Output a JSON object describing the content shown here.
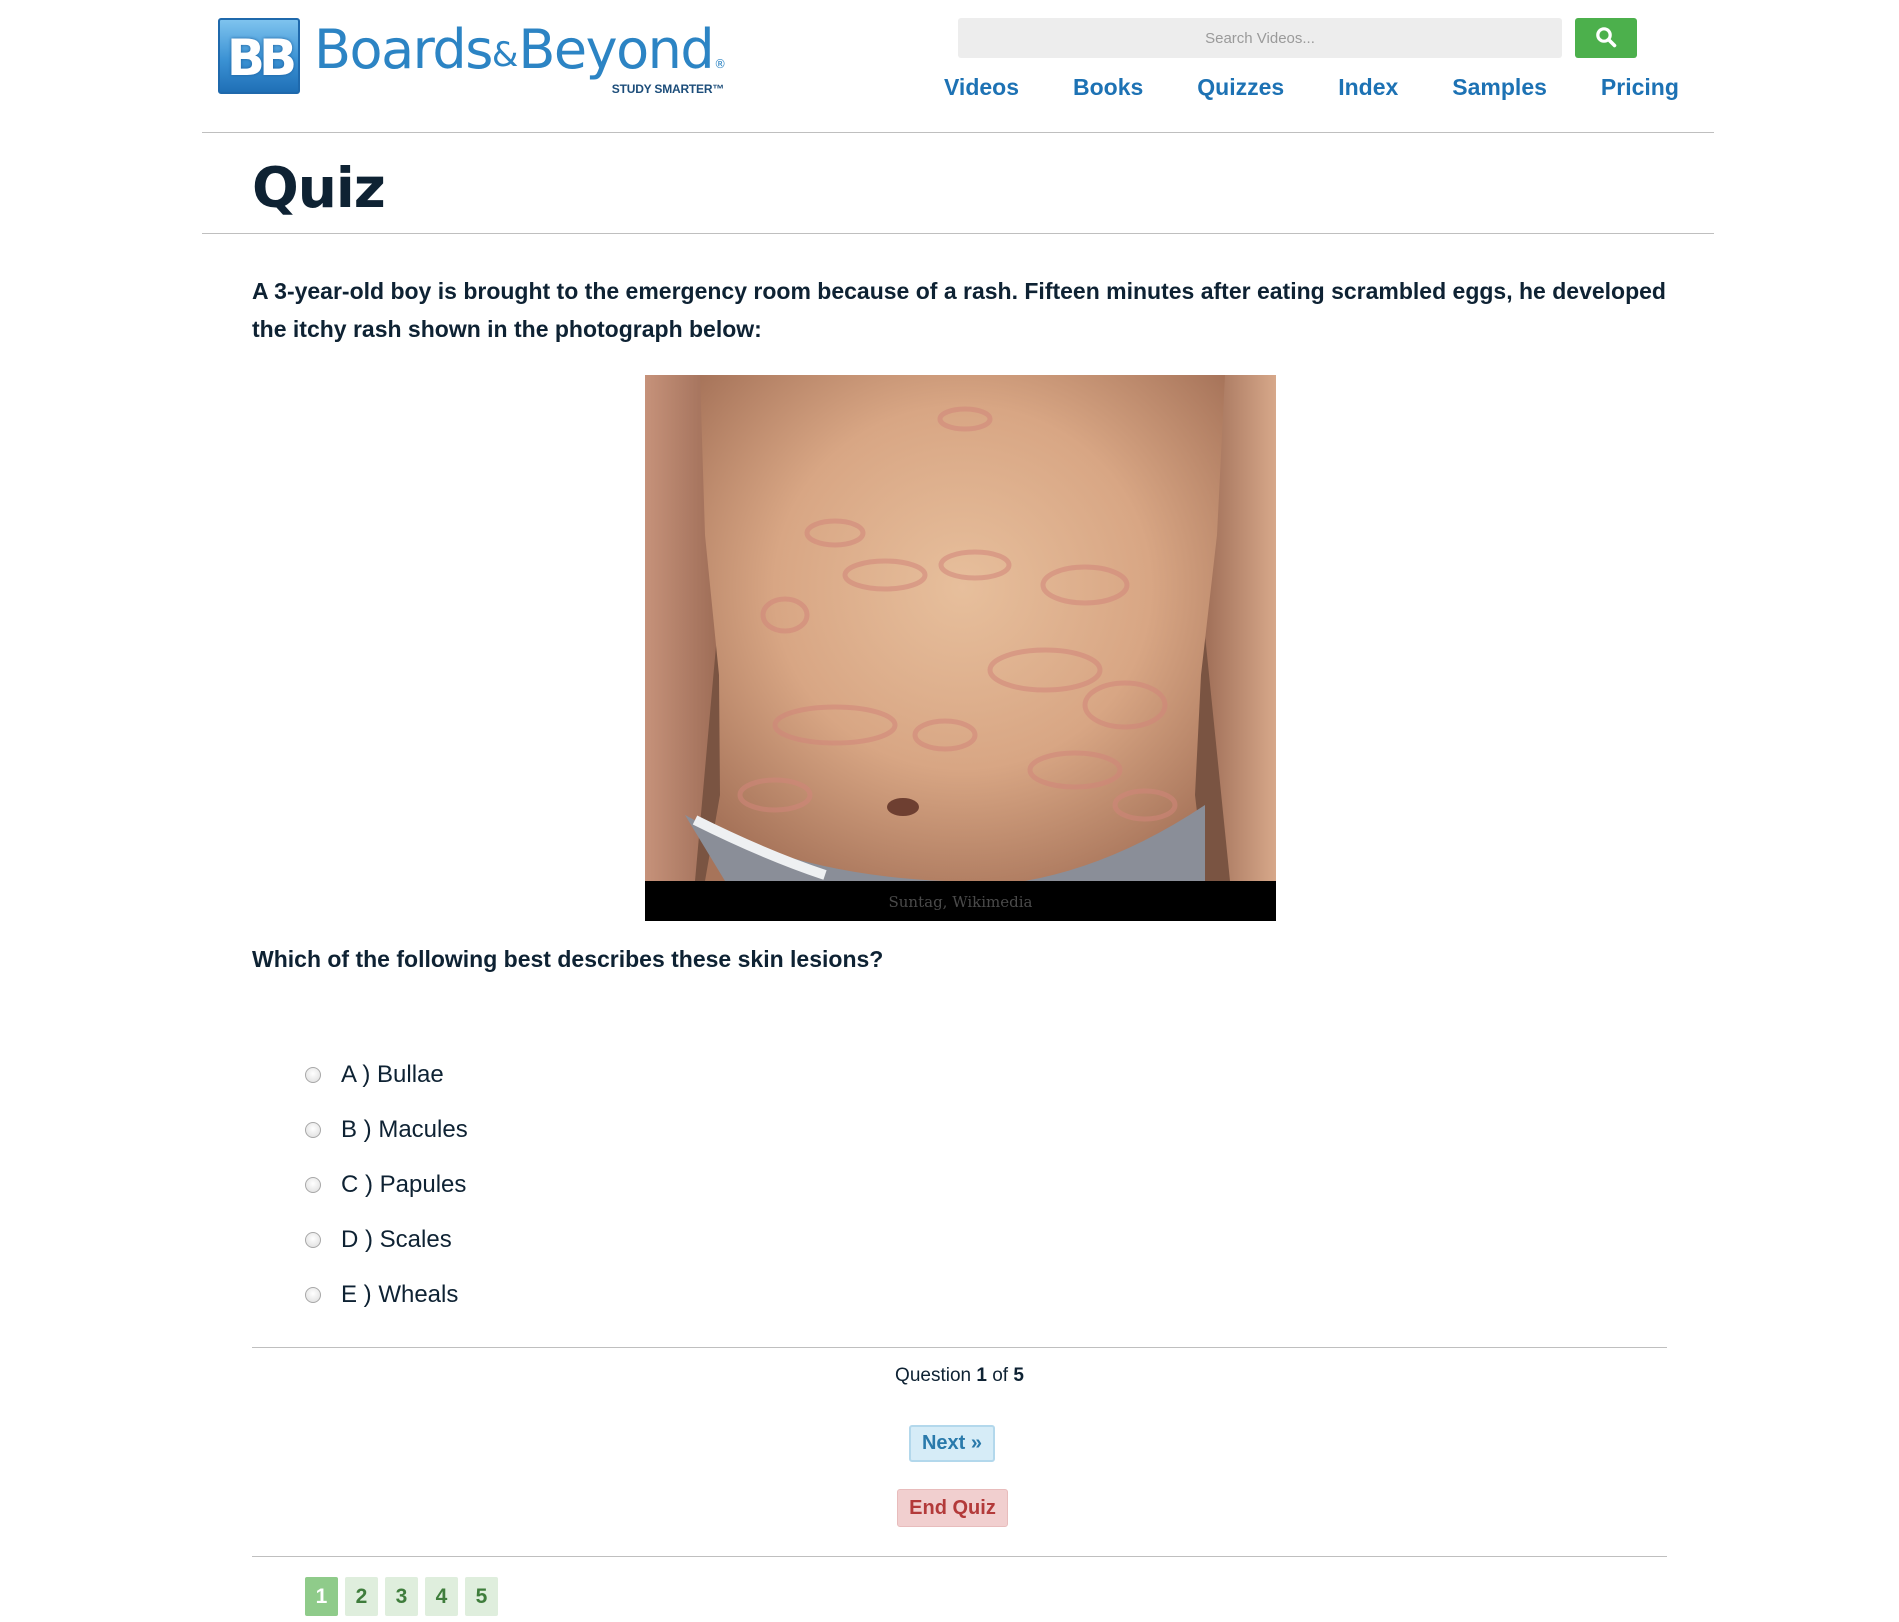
{
  "header": {
    "logo_badge": "BB",
    "logo_brand_first": "Boards",
    "logo_brand_amp": "&",
    "logo_brand_second": "Beyond",
    "logo_reg": "®",
    "logo_tagline": "STUDY SMARTER™",
    "search": {
      "placeholder": "Search Videos...",
      "value": "",
      "icon": "search-icon"
    },
    "nav": [
      {
        "label": "Videos"
      },
      {
        "label": "Books"
      },
      {
        "label": "Quizzes"
      },
      {
        "label": "Index"
      },
      {
        "label": "Samples"
      },
      {
        "label": "Pricing"
      }
    ]
  },
  "page": {
    "title": "Quiz"
  },
  "quiz": {
    "stem": "A 3-year-old boy is brought to the emergency room because of a rash. Fifteen minutes after eating scrambled eggs, he developed the itchy rash shown in the photograph below:",
    "photo_credit": "Suntag, Wikimedia",
    "prompt": "Which of the following best describes these skin lesions?",
    "options": [
      {
        "label": "A ) Bullae",
        "selected": false
      },
      {
        "label": "B ) Macules",
        "selected": false
      },
      {
        "label": "C ) Papules",
        "selected": false
      },
      {
        "label": "D ) Scales",
        "selected": false
      },
      {
        "label": "E ) Wheals",
        "selected": false
      }
    ],
    "progress": {
      "prefix": "Question",
      "current": "1",
      "of_label": "of",
      "total": "5"
    },
    "next_label": "Next »",
    "end_label": "End Quiz",
    "pages": [
      {
        "label": "1",
        "active": true
      },
      {
        "label": "2",
        "active": false
      },
      {
        "label": "3",
        "active": false
      },
      {
        "label": "4",
        "active": false
      },
      {
        "label": "5",
        "active": false
      }
    ]
  },
  "colors": {
    "brand_blue": "#2c84c4",
    "nav_blue": "#1d72b4",
    "search_green": "#4cb04c",
    "text_dark": "#0e2233",
    "next_bg": "#d6ecf7",
    "end_bg": "#f1cfcf",
    "end_text": "#b33a3a",
    "page_active": "#8fcb8a",
    "page_inactive": "#dfeedd"
  }
}
